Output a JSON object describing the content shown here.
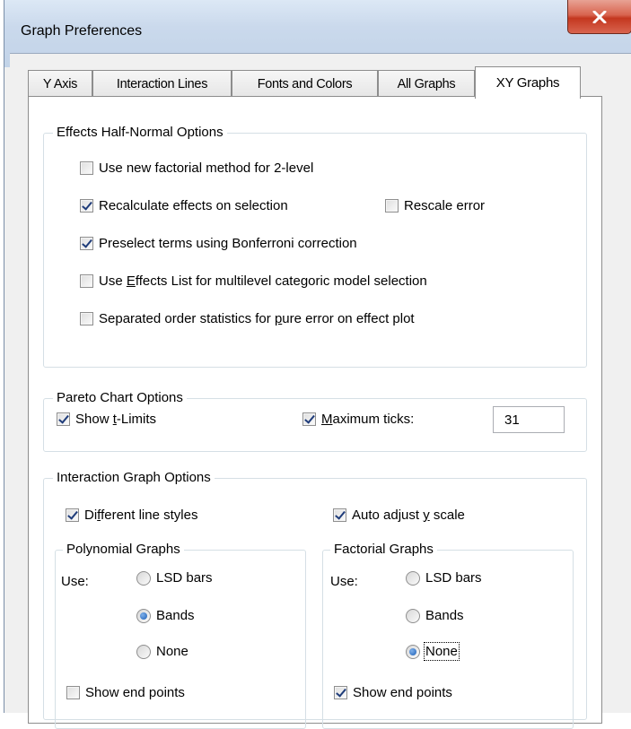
{
  "window": {
    "title": "Graph Preferences"
  },
  "tabs": [
    {
      "label": "Y Axis"
    },
    {
      "label": "Interaction Lines"
    },
    {
      "label": "Fonts and Colors"
    },
    {
      "label": "All Graphs"
    },
    {
      "label": "XY Graphs",
      "active": true
    }
  ],
  "effects": {
    "title": "Effects Half-Normal Options",
    "new_factorial": {
      "label": "Use new factorial method for 2-level",
      "checked": false
    },
    "recalc": {
      "label": "Recalculate effects on selection",
      "checked": true
    },
    "rescale": {
      "label": "Rescale error",
      "checked": false
    },
    "preselect": {
      "label": "Preselect terms using Bonferroni correction",
      "checked": true
    },
    "effects_list": {
      "pre": "Use ",
      "accel": "E",
      "post": "ffects List for multilevel categoric model selection",
      "checked": false
    },
    "separated": {
      "pre": "Separated order statistics for ",
      "accel": "p",
      "post": "ure error on effect plot",
      "checked": false
    }
  },
  "pareto": {
    "title": "Pareto Chart Options",
    "show_limits": {
      "pre": "Show ",
      "accel": "t",
      "post": "-Limits",
      "checked": true
    },
    "max_ticks": {
      "pre": "",
      "accel": "M",
      "post": "aximum ticks:",
      "checked": true,
      "value": "31"
    }
  },
  "interaction": {
    "title": "Interaction Graph Options",
    "line_styles": {
      "pre": "Di",
      "accel": "f",
      "post": "ferent line styles",
      "checked": true
    },
    "auto_adjust": {
      "pre": "Auto adjust ",
      "accel": "y",
      "post": " scale",
      "checked": true
    },
    "polynomial": {
      "title": "Polynomial Graphs",
      "use_label": "Use:",
      "options": [
        "LSD bars",
        "Bands",
        "None"
      ],
      "selected": "Bands",
      "show_end": {
        "label": "Show end points",
        "checked": false
      }
    },
    "factorial": {
      "title": "Factorial Graphs",
      "use_label": "Use:",
      "options": [
        "LSD bars",
        "Bands",
        "None"
      ],
      "selected": "None",
      "show_end": {
        "label": "Show end points",
        "checked": true
      }
    }
  },
  "colors": {
    "close_button": "#c4371f",
    "radio_dot": "#1c5fb6",
    "check_mark": "#1f3c7a"
  }
}
